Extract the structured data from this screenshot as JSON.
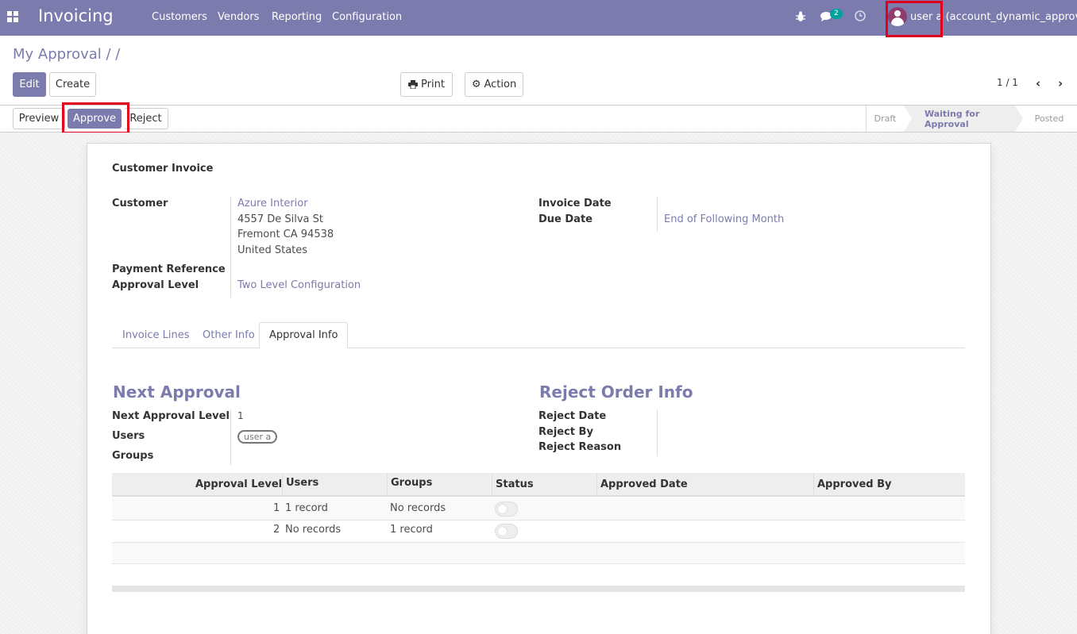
{
  "navbar": {
    "brand": "Invoicing",
    "menu": [
      "Customers",
      "Vendors",
      "Reporting",
      "Configuration"
    ],
    "chat_count": "2",
    "user": "user a (account_dynamic_approval)",
    "bg_color": "#7c7bad"
  },
  "breadcrumb": "My Approval / /",
  "buttons": {
    "edit": "Edit",
    "create": "Create",
    "print": "Print",
    "action": "Action"
  },
  "pager": {
    "value": "1 / 1",
    "prev": "‹",
    "next": "›"
  },
  "statusbar": {
    "preview": "Preview",
    "approve": "Approve",
    "reject": "Reject",
    "stages": [
      "Draft",
      "Waiting for Approval",
      "Posted"
    ],
    "active_stage": "Waiting for Approval"
  },
  "form": {
    "doc_type": "Customer Invoice",
    "customer_label": "Customer",
    "customer_name": "Azure Interior",
    "address": [
      "4557 De Silva St",
      "Fremont CA 94538",
      "United States"
    ],
    "payment_reference_label": "Payment Reference",
    "approval_level_label": "Approval Level",
    "approval_level": "Two Level Configuration",
    "invoice_date_label": "Invoice Date",
    "due_date_label": "Due Date",
    "due_date": "End of Following Month"
  },
  "tabs": [
    "Invoice Lines",
    "Other Info",
    "Approval Info"
  ],
  "active_tab": "Approval Info",
  "next_approval": {
    "title": "Next Approval",
    "level_label": "Next Approval Level",
    "level": "1",
    "users_label": "Users",
    "user_tag": "user a",
    "groups_label": "Groups"
  },
  "reject_info": {
    "title": "Reject Order Info",
    "date_label": "Reject Date",
    "by_label": "Reject By",
    "reason_label": "Reject Reason"
  },
  "table": {
    "headers": [
      "Approval Level",
      "Users",
      "Groups",
      "Status",
      "Approved Date",
      "Approved By"
    ],
    "rows": [
      {
        "level": "1",
        "users": "1 record",
        "groups": "No records",
        "status": false
      },
      {
        "level": "2",
        "users": "No records",
        "groups": "1 record",
        "status": false
      }
    ]
  }
}
